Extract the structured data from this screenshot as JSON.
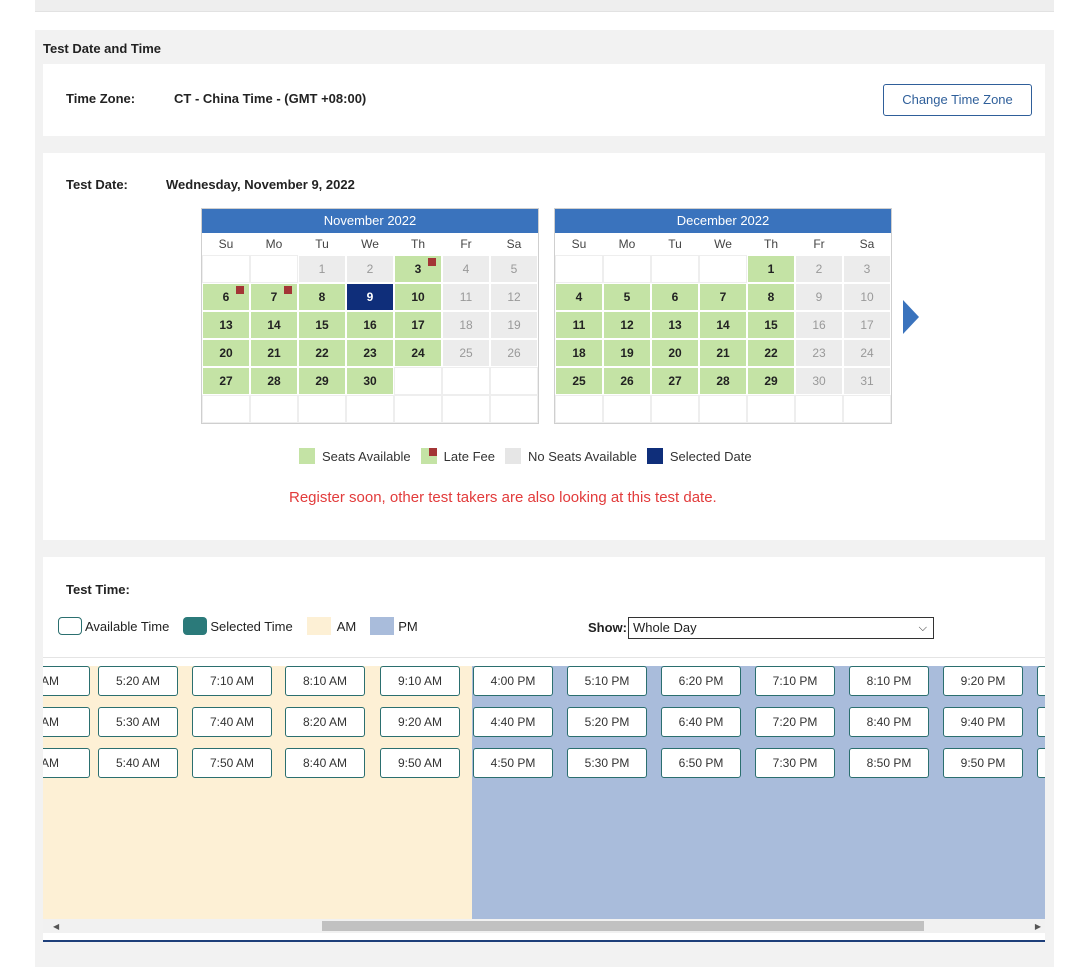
{
  "section": {
    "title": "Test Date and Time"
  },
  "timezone": {
    "label": "Time Zone:",
    "value": "CT - China Time - (GMT +08:00)",
    "button": "Change Time Zone"
  },
  "test_date": {
    "label": "Test Date:",
    "value": "Wednesday, November 9, 2022"
  },
  "dow": [
    "Su",
    "Mo",
    "Tu",
    "We",
    "Th",
    "Fr",
    "Sa"
  ],
  "calendars": [
    {
      "title": "November 2022",
      "days": [
        {
          "d": "",
          "s": "empty"
        },
        {
          "d": "",
          "s": "empty"
        },
        {
          "d": "1",
          "s": "noseat"
        },
        {
          "d": "2",
          "s": "noseat"
        },
        {
          "d": "3",
          "s": "avail late"
        },
        {
          "d": "4",
          "s": "noseat"
        },
        {
          "d": "5",
          "s": "noseat"
        },
        {
          "d": "6",
          "s": "avail late"
        },
        {
          "d": "7",
          "s": "avail late"
        },
        {
          "d": "8",
          "s": "avail"
        },
        {
          "d": "9",
          "s": "sel"
        },
        {
          "d": "10",
          "s": "avail"
        },
        {
          "d": "11",
          "s": "noseat"
        },
        {
          "d": "12",
          "s": "noseat"
        },
        {
          "d": "13",
          "s": "avail"
        },
        {
          "d": "14",
          "s": "avail"
        },
        {
          "d": "15",
          "s": "avail"
        },
        {
          "d": "16",
          "s": "avail"
        },
        {
          "d": "17",
          "s": "avail"
        },
        {
          "d": "18",
          "s": "noseat"
        },
        {
          "d": "19",
          "s": "noseat"
        },
        {
          "d": "20",
          "s": "avail"
        },
        {
          "d": "21",
          "s": "avail"
        },
        {
          "d": "22",
          "s": "avail"
        },
        {
          "d": "23",
          "s": "avail"
        },
        {
          "d": "24",
          "s": "avail"
        },
        {
          "d": "25",
          "s": "noseat"
        },
        {
          "d": "26",
          "s": "noseat"
        },
        {
          "d": "27",
          "s": "avail"
        },
        {
          "d": "28",
          "s": "avail"
        },
        {
          "d": "29",
          "s": "avail"
        },
        {
          "d": "30",
          "s": "avail"
        },
        {
          "d": "",
          "s": "empty"
        },
        {
          "d": "",
          "s": "empty"
        },
        {
          "d": "",
          "s": "empty"
        },
        {
          "d": "",
          "s": "empty"
        },
        {
          "d": "",
          "s": "empty"
        },
        {
          "d": "",
          "s": "empty"
        },
        {
          "d": "",
          "s": "empty"
        },
        {
          "d": "",
          "s": "empty"
        },
        {
          "d": "",
          "s": "empty"
        },
        {
          "d": "",
          "s": "empty"
        }
      ]
    },
    {
      "title": "December 2022",
      "days": [
        {
          "d": "",
          "s": "empty"
        },
        {
          "d": "",
          "s": "empty"
        },
        {
          "d": "",
          "s": "empty"
        },
        {
          "d": "",
          "s": "empty"
        },
        {
          "d": "1",
          "s": "avail"
        },
        {
          "d": "2",
          "s": "noseat"
        },
        {
          "d": "3",
          "s": "noseat"
        },
        {
          "d": "4",
          "s": "avail"
        },
        {
          "d": "5",
          "s": "avail"
        },
        {
          "d": "6",
          "s": "avail"
        },
        {
          "d": "7",
          "s": "avail"
        },
        {
          "d": "8",
          "s": "avail"
        },
        {
          "d": "9",
          "s": "noseat"
        },
        {
          "d": "10",
          "s": "noseat"
        },
        {
          "d": "11",
          "s": "avail"
        },
        {
          "d": "12",
          "s": "avail"
        },
        {
          "d": "13",
          "s": "avail"
        },
        {
          "d": "14",
          "s": "avail"
        },
        {
          "d": "15",
          "s": "avail"
        },
        {
          "d": "16",
          "s": "noseat"
        },
        {
          "d": "17",
          "s": "noseat"
        },
        {
          "d": "18",
          "s": "avail"
        },
        {
          "d": "19",
          "s": "avail"
        },
        {
          "d": "20",
          "s": "avail"
        },
        {
          "d": "21",
          "s": "avail"
        },
        {
          "d": "22",
          "s": "avail"
        },
        {
          "d": "23",
          "s": "noseat"
        },
        {
          "d": "24",
          "s": "noseat"
        },
        {
          "d": "25",
          "s": "avail"
        },
        {
          "d": "26",
          "s": "avail"
        },
        {
          "d": "27",
          "s": "avail"
        },
        {
          "d": "28",
          "s": "avail"
        },
        {
          "d": "29",
          "s": "avail"
        },
        {
          "d": "30",
          "s": "noseat"
        },
        {
          "d": "31",
          "s": "noseat"
        },
        {
          "d": "",
          "s": "empty"
        },
        {
          "d": "",
          "s": "empty"
        },
        {
          "d": "",
          "s": "empty"
        },
        {
          "d": "",
          "s": "empty"
        },
        {
          "d": "",
          "s": "empty"
        },
        {
          "d": "",
          "s": "empty"
        },
        {
          "d": "",
          "s": "empty"
        }
      ]
    }
  ],
  "date_legend": {
    "available": "Seats Available",
    "late": "Late Fee",
    "noseat": "No Seats Available",
    "selected": "Selected Date"
  },
  "warning": "Register soon, other test takers are also looking at this test date.",
  "test_time": {
    "label": "Test Time:",
    "legend": {
      "available": "Available Time",
      "selected": "Selected Time",
      "am": "AM",
      "pm": "PM"
    },
    "show_label": "Show:",
    "show_value": "Whole Day",
    "columns": [
      [
        "AM",
        "AM",
        "AM"
      ],
      [
        "5:20 AM",
        "5:30 AM",
        "5:40 AM"
      ],
      [
        "7:10 AM",
        "7:40 AM",
        "7:50 AM"
      ],
      [
        "8:10 AM",
        "8:20 AM",
        "8:40 AM"
      ],
      [
        "9:10 AM",
        "9:20 AM",
        "9:50 AM"
      ],
      [
        "4:00 PM",
        "4:40 PM",
        "4:50 PM"
      ],
      [
        "5:10 PM",
        "5:20 PM",
        "5:30 PM"
      ],
      [
        "6:20 PM",
        "6:40 PM",
        "6:50 PM"
      ],
      [
        "7:10 PM",
        "7:20 PM",
        "7:30 PM"
      ],
      [
        "8:10 PM",
        "8:40 PM",
        "8:50 PM"
      ],
      [
        "9:20 PM",
        "9:40 PM",
        "9:50 PM"
      ],
      [
        "",
        "",
        ""
      ]
    ]
  },
  "colors": {
    "header_blue": "#3a73bd",
    "available_green": "#c4e3a5",
    "late_red": "#a33535",
    "selected_navy": "#0f2e7a",
    "warning_red": "#e23b3b",
    "am_bg": "#fdf0d5",
    "pm_bg": "#a9bcdb"
  }
}
